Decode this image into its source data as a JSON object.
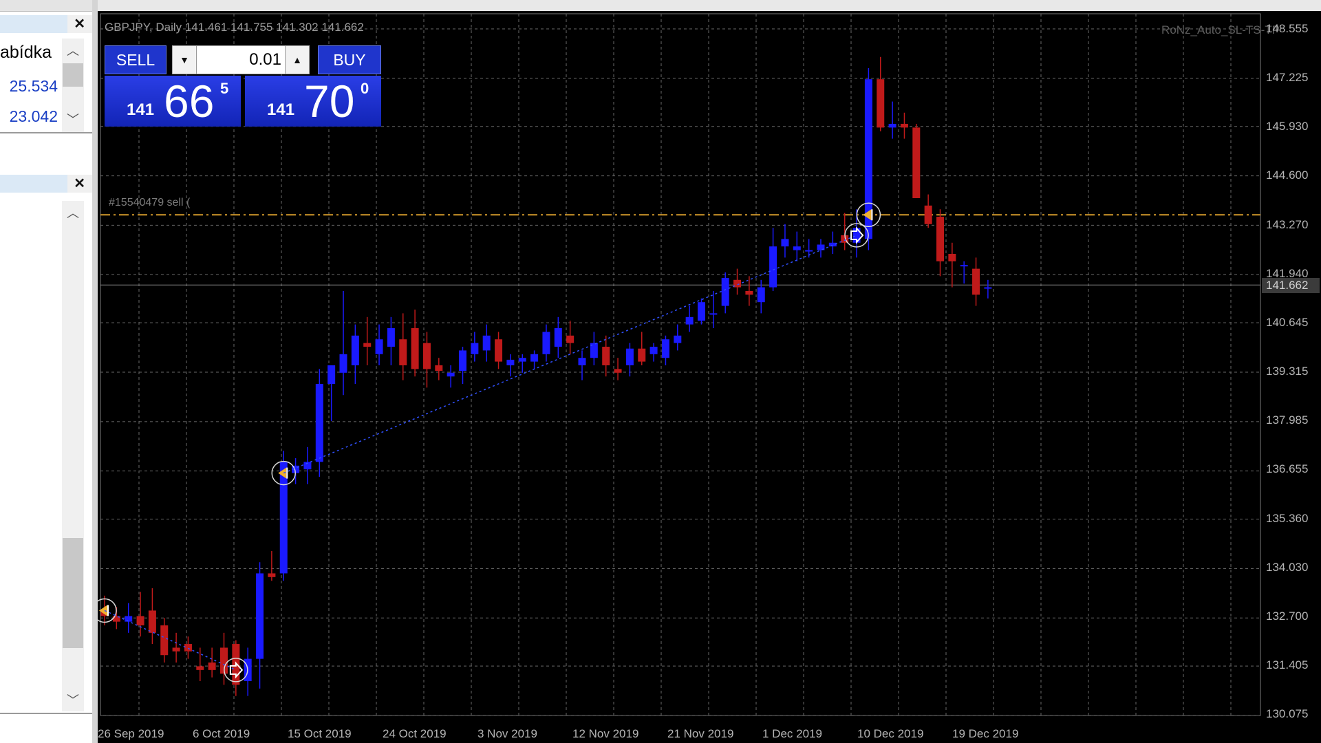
{
  "left_panel": {
    "market_watch": {
      "header": "abídka",
      "rows": [
        "25.534",
        "23.042"
      ]
    }
  },
  "chart": {
    "title": "GBPJPY, Daily  141.461 141.755 141.302 141.662",
    "ea_label": "RoNz_Auto_SL-TS-TP",
    "order_label": "#15540479 sell (",
    "current_price": "141.662"
  },
  "trade_panel": {
    "sell_label": "SELL",
    "buy_label": "BUY",
    "lot": "0.01",
    "sell": {
      "small": "141",
      "big": "66",
      "sup": "5"
    },
    "buy": {
      "small": "141",
      "big": "70",
      "sup": "0"
    }
  },
  "colors": {
    "bull": "#1a1aff",
    "bear": "#c01a1a",
    "grid": "#6a6a6a",
    "order_line": "#d49a2a",
    "bid_line": "#8a8a8a"
  },
  "chart_data": {
    "type": "candlestick",
    "ylim": [
      130.075,
      148.555
    ],
    "y_ticks": [
      "148.555",
      "147.225",
      "145.930",
      "144.600",
      "143.270",
      "141.940",
      "140.645",
      "139.315",
      "137.985",
      "136.655",
      "135.360",
      "134.030",
      "132.700",
      "131.405",
      "130.075"
    ],
    "x_ticks": [
      "26 Sep 2019",
      "6 Oct 2019",
      "15 Oct 2019",
      "24 Oct 2019",
      "3 Nov 2019",
      "12 Nov 2019",
      "21 Nov 2019",
      "1 Dec 2019",
      "10 Dec 2019",
      "19 Dec 2019"
    ],
    "current_price": 141.662,
    "order_price": 143.55,
    "candles": [
      {
        "date": "2019-09-24",
        "o": 132.9,
        "h": 133.3,
        "l": 132.5,
        "c": 132.75
      },
      {
        "date": "2019-09-25",
        "o": 132.75,
        "h": 133.0,
        "l": 132.4,
        "c": 132.6
      },
      {
        "date": "2019-09-26",
        "o": 132.6,
        "h": 133.1,
        "l": 132.3,
        "c": 132.75
      },
      {
        "date": "2019-09-27",
        "o": 132.75,
        "h": 133.4,
        "l": 132.2,
        "c": 132.5
      },
      {
        "date": "2019-09-30",
        "o": 132.9,
        "h": 133.5,
        "l": 132.0,
        "c": 132.3
      },
      {
        "date": "2019-10-01",
        "o": 132.5,
        "h": 132.7,
        "l": 131.5,
        "c": 131.7
      },
      {
        "date": "2019-10-02",
        "o": 131.9,
        "h": 132.3,
        "l": 131.5,
        "c": 131.8
      },
      {
        "date": "2019-10-03",
        "o": 132.0,
        "h": 132.2,
        "l": 131.6,
        "c": 131.8
      },
      {
        "date": "2019-10-04",
        "o": 131.4,
        "h": 131.9,
        "l": 131.0,
        "c": 131.3
      },
      {
        "date": "2019-10-07",
        "o": 131.5,
        "h": 131.9,
        "l": 131.1,
        "c": 131.3
      },
      {
        "date": "2019-10-08",
        "o": 131.9,
        "h": 132.3,
        "l": 130.9,
        "c": 131.2
      },
      {
        "date": "2019-10-09",
        "o": 132.0,
        "h": 132.1,
        "l": 130.6,
        "c": 130.9
      },
      {
        "date": "2019-10-10",
        "o": 131.0,
        "h": 131.9,
        "l": 130.6,
        "c": 131.6
      },
      {
        "date": "2019-10-11",
        "o": 131.6,
        "h": 134.2,
        "l": 130.8,
        "c": 133.9
      },
      {
        "date": "2019-10-14",
        "o": 133.9,
        "h": 134.5,
        "l": 133.7,
        "c": 133.8
      },
      {
        "date": "2019-10-15",
        "o": 133.9,
        "h": 137.2,
        "l": 133.7,
        "c": 136.9
      },
      {
        "date": "2019-10-16",
        "o": 136.6,
        "h": 137.0,
        "l": 136.3,
        "c": 136.8
      },
      {
        "date": "2019-10-17",
        "o": 136.7,
        "h": 137.3,
        "l": 136.3,
        "c": 136.9
      },
      {
        "date": "2019-10-18",
        "o": 136.9,
        "h": 139.4,
        "l": 136.5,
        "c": 139.0
      },
      {
        "date": "2019-10-21",
        "o": 139.0,
        "h": 139.5,
        "l": 138.0,
        "c": 139.5
      },
      {
        "date": "2019-10-22",
        "o": 139.3,
        "h": 141.5,
        "l": 138.7,
        "c": 139.8
      },
      {
        "date": "2019-10-23",
        "o": 139.5,
        "h": 140.6,
        "l": 139.0,
        "c": 140.3
      },
      {
        "date": "2019-10-24",
        "o": 140.1,
        "h": 140.8,
        "l": 139.5,
        "c": 140.0
      },
      {
        "date": "2019-10-25",
        "o": 139.8,
        "h": 140.6,
        "l": 139.5,
        "c": 140.2
      },
      {
        "date": "2019-10-28",
        "o": 140.0,
        "h": 140.8,
        "l": 139.5,
        "c": 140.5
      },
      {
        "date": "2019-10-29",
        "o": 140.2,
        "h": 140.9,
        "l": 139.1,
        "c": 139.5
      },
      {
        "date": "2019-10-30",
        "o": 140.5,
        "h": 141.0,
        "l": 139.2,
        "c": 139.4
      },
      {
        "date": "2019-10-31",
        "o": 140.1,
        "h": 140.4,
        "l": 138.9,
        "c": 139.4
      },
      {
        "date": "2019-11-01",
        "o": 139.5,
        "h": 139.7,
        "l": 139.1,
        "c": 139.35
      },
      {
        "date": "2019-11-04",
        "o": 139.2,
        "h": 139.5,
        "l": 138.9,
        "c": 139.3
      },
      {
        "date": "2019-11-05",
        "o": 139.35,
        "h": 140.0,
        "l": 139.0,
        "c": 139.9
      },
      {
        "date": "2019-11-06",
        "o": 139.8,
        "h": 140.4,
        "l": 139.6,
        "c": 140.1
      },
      {
        "date": "2019-11-07",
        "o": 139.9,
        "h": 140.6,
        "l": 139.6,
        "c": 140.3
      },
      {
        "date": "2019-11-08",
        "o": 140.2,
        "h": 140.4,
        "l": 139.4,
        "c": 139.6
      },
      {
        "date": "2019-11-11",
        "o": 139.5,
        "h": 139.8,
        "l": 139.2,
        "c": 139.65
      },
      {
        "date": "2019-11-12",
        "o": 139.6,
        "h": 139.8,
        "l": 139.3,
        "c": 139.7
      },
      {
        "date": "2019-11-13",
        "o": 139.6,
        "h": 139.9,
        "l": 139.4,
        "c": 139.8
      },
      {
        "date": "2019-11-14",
        "o": 139.8,
        "h": 140.6,
        "l": 139.6,
        "c": 140.4
      },
      {
        "date": "2019-11-15",
        "o": 140.0,
        "h": 140.8,
        "l": 139.7,
        "c": 140.5
      },
      {
        "date": "2019-11-18",
        "o": 140.3,
        "h": 140.7,
        "l": 139.8,
        "c": 140.1
      },
      {
        "date": "2019-11-19",
        "o": 139.5,
        "h": 139.9,
        "l": 139.1,
        "c": 139.7
      },
      {
        "date": "2019-11-20",
        "o": 139.7,
        "h": 140.4,
        "l": 139.5,
        "c": 140.1
      },
      {
        "date": "2019-11-21",
        "o": 140.0,
        "h": 140.3,
        "l": 139.2,
        "c": 139.5
      },
      {
        "date": "2019-11-22",
        "o": 139.4,
        "h": 139.7,
        "l": 139.1,
        "c": 139.3
      },
      {
        "date": "2019-11-25",
        "o": 139.5,
        "h": 140.1,
        "l": 139.2,
        "c": 139.95
      },
      {
        "date": "2019-11-26",
        "o": 139.95,
        "h": 140.4,
        "l": 139.5,
        "c": 139.6
      },
      {
        "date": "2019-11-27",
        "o": 139.8,
        "h": 140.1,
        "l": 139.6,
        "c": 140.0
      },
      {
        "date": "2019-11-28",
        "o": 139.7,
        "h": 140.3,
        "l": 139.5,
        "c": 140.2
      },
      {
        "date": "2019-11-29",
        "o": 140.1,
        "h": 140.6,
        "l": 139.9,
        "c": 140.3
      },
      {
        "date": "2019-12-02",
        "o": 140.6,
        "h": 141.1,
        "l": 140.4,
        "c": 140.8
      },
      {
        "date": "2019-12-03",
        "o": 140.7,
        "h": 141.3,
        "l": 140.6,
        "c": 141.2
      },
      {
        "date": "2019-12-04",
        "o": 140.9,
        "h": 141.5,
        "l": 140.5,
        "c": 140.9
      },
      {
        "date": "2019-12-05",
        "o": 141.1,
        "h": 142.0,
        "l": 140.9,
        "c": 141.85
      },
      {
        "date": "2019-12-06",
        "o": 141.8,
        "h": 142.1,
        "l": 141.4,
        "c": 141.6
      },
      {
        "date": "2019-12-09",
        "o": 141.5,
        "h": 141.9,
        "l": 141.1,
        "c": 141.4
      },
      {
        "date": "2019-12-10",
        "o": 141.2,
        "h": 141.8,
        "l": 140.9,
        "c": 141.6
      },
      {
        "date": "2019-12-11",
        "o": 141.6,
        "h": 143.2,
        "l": 141.5,
        "c": 142.7
      },
      {
        "date": "2019-12-12",
        "o": 142.7,
        "h": 143.3,
        "l": 142.4,
        "c": 142.9
      },
      {
        "date": "2019-12-13",
        "o": 142.6,
        "h": 143.1,
        "l": 142.3,
        "c": 142.7
      },
      {
        "date": "2019-12-16",
        "o": 142.6,
        "h": 142.9,
        "l": 142.4,
        "c": 142.6
      },
      {
        "date": "2019-12-17",
        "o": 142.6,
        "h": 142.9,
        "l": 142.4,
        "c": 142.75
      },
      {
        "date": "2019-12-18",
        "o": 142.7,
        "h": 143.1,
        "l": 142.5,
        "c": 142.8
      },
      {
        "date": "2019-12-19",
        "o": 143.0,
        "h": 143.6,
        "l": 142.6,
        "c": 142.8
      },
      {
        "date": "2019-12-20",
        "o": 142.8,
        "h": 143.7,
        "l": 142.4,
        "c": 143.2
      },
      {
        "date": "2019-12-23",
        "o": 142.9,
        "h": 147.5,
        "l": 142.6,
        "c": 147.2
      },
      {
        "date": "2019-12-24",
        "o": 147.2,
        "h": 147.8,
        "l": 145.8,
        "c": 145.9
      },
      {
        "date": "2019-12-26",
        "o": 145.9,
        "h": 146.6,
        "l": 145.6,
        "c": 146.0
      },
      {
        "date": "2019-12-27",
        "o": 146.0,
        "h": 146.3,
        "l": 145.6,
        "c": 145.9
      },
      {
        "date": "2019-12-30",
        "o": 145.9,
        "h": 146.0,
        "l": 144.0,
        "c": 144.0
      },
      {
        "date": "2019-12-31",
        "o": 143.8,
        "h": 144.1,
        "l": 143.2,
        "c": 143.3
      },
      {
        "date": "2020-01-01",
        "o": 143.5,
        "h": 143.7,
        "l": 141.9,
        "c": 142.3
      },
      {
        "date": "2020-01-02",
        "o": 142.5,
        "h": 142.8,
        "l": 141.6,
        "c": 142.3
      },
      {
        "date": "2020-01-03",
        "o": 142.2,
        "h": 142.3,
        "l": 141.7,
        "c": 142.2
      },
      {
        "date": "2020-01-06",
        "o": 142.1,
        "h": 142.4,
        "l": 141.1,
        "c": 141.4
      },
      {
        "date": "2020-01-07",
        "o": 141.6,
        "h": 141.8,
        "l": 141.3,
        "c": 141.6
      }
    ],
    "trade_markers": [
      {
        "type": "sell",
        "index": 0,
        "price": 132.9
      },
      {
        "type": "close",
        "index": 11,
        "price": 131.3
      },
      {
        "type": "sell",
        "index": 15,
        "price": 136.6
      },
      {
        "type": "close",
        "index": 63,
        "price": 143.0
      },
      {
        "type": "sell",
        "index": 64,
        "price": 143.55
      }
    ]
  }
}
